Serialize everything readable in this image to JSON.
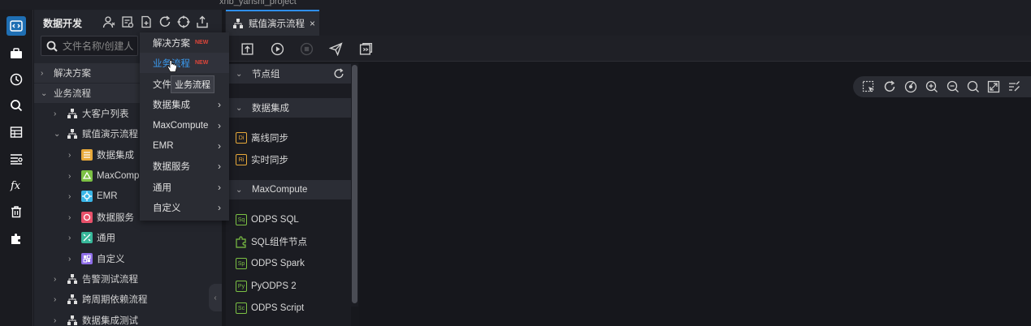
{
  "window": {
    "project_title": "xnb_yanshi_project"
  },
  "sidebar": {
    "title": "数据开发",
    "search_placeholder": "文件名称/创建人",
    "tree": [
      {
        "label": "解决方案",
        "level": 0,
        "expanded": false
      },
      {
        "label": "业务流程",
        "level": 0,
        "expanded": true
      },
      {
        "label": "大客户列表",
        "level": 1,
        "expanded": false,
        "icon": "workflow-icon"
      },
      {
        "label": "赋值演示流程",
        "level": 1,
        "expanded": true,
        "icon": "workflow-icon"
      },
      {
        "label": "数据集成",
        "level": 2,
        "expanded": false,
        "icon": "data-integration-icon",
        "color": "#e8a93a"
      },
      {
        "label": "MaxCompu",
        "level": 2,
        "expanded": false,
        "icon": "maxcompute-icon",
        "color": "#7cc144"
      },
      {
        "label": "EMR",
        "level": 2,
        "expanded": false,
        "icon": "emr-icon",
        "color": "#3ab6e8"
      },
      {
        "label": "数据服务",
        "level": 2,
        "expanded": false,
        "icon": "data-service-icon",
        "color": "#e8516a"
      },
      {
        "label": "通用",
        "level": 2,
        "expanded": false,
        "icon": "general-icon",
        "color": "#37b89a"
      },
      {
        "label": "自定义",
        "level": 2,
        "expanded": false,
        "icon": "custom-icon",
        "color": "#8e6ee8"
      },
      {
        "label": "告警测试流程",
        "level": 1,
        "expanded": false,
        "icon": "workflow-icon"
      },
      {
        "label": "跨周期依赖流程",
        "level": 1,
        "expanded": false,
        "icon": "workflow-icon"
      },
      {
        "label": "数据集成测试",
        "level": 1,
        "expanded": false,
        "icon": "workflow-icon"
      }
    ]
  },
  "context_menu": {
    "items": [
      {
        "label": "解决方案",
        "badge": "NEW",
        "submenu": false
      },
      {
        "label": "业务流程",
        "badge": "NEW",
        "submenu": false,
        "highlighted": true
      },
      {
        "label": "文件",
        "badge": "",
        "submenu": false
      },
      {
        "label": "数据集成",
        "badge": "",
        "submenu": true
      },
      {
        "label": "MaxCompute",
        "badge": "",
        "submenu": true
      },
      {
        "label": "EMR",
        "badge": "",
        "submenu": true
      },
      {
        "label": "数据服务",
        "badge": "",
        "submenu": true
      },
      {
        "label": "通用",
        "badge": "",
        "submenu": true
      },
      {
        "label": "自定义",
        "badge": "",
        "submenu": true
      }
    ],
    "tooltip": "业务流程"
  },
  "editor_tab": {
    "label": "赋值演示流程",
    "close_glyph": "×"
  },
  "node_panel": {
    "sections": [
      {
        "title": "节点组",
        "items": []
      },
      {
        "title": "数据集成",
        "items": [
          {
            "label": "离线同步",
            "badge": "Di",
            "color": "#e8a93a"
          },
          {
            "label": "实时同步",
            "badge": "Ri",
            "color": "#e8a93a"
          }
        ]
      },
      {
        "title": "MaxCompute",
        "items": [
          {
            "label": "ODPS SQL",
            "badge": "Sq",
            "color": "#7cc144"
          },
          {
            "label": "SQL组件节点",
            "badge": "",
            "color": "#7cc144"
          },
          {
            "label": "ODPS Spark",
            "badge": "Sp",
            "color": "#7cc144"
          },
          {
            "label": "PyODPS 2",
            "badge": "Py",
            "color": "#7cc144"
          },
          {
            "label": "ODPS Script",
            "badge": "Sc",
            "color": "#7cc144"
          }
        ]
      }
    ]
  },
  "colors": {
    "accent": "#2f8ff0",
    "menu_highlight_text": "#3a9bf0",
    "new_badge": "#e0463a"
  }
}
